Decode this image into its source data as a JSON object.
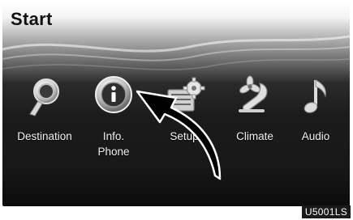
{
  "screen": {
    "title": "Start"
  },
  "menu": [
    {
      "key": "destination",
      "label": "Destination",
      "icon": "destination-magnifier-icon"
    },
    {
      "key": "info-phone",
      "label": "Info.\nPhone",
      "icon": "info-icon"
    },
    {
      "key": "setup",
      "label": "Setup",
      "icon": "setup-gear-icon"
    },
    {
      "key": "climate",
      "label": "Climate",
      "icon": "climate-fan-seat-icon"
    },
    {
      "key": "audio",
      "label": "Audio",
      "icon": "music-note-icon"
    }
  ],
  "figure_code": "U5001LS",
  "colors": {
    "background_dark": "#181818",
    "label": "#f2f2f2",
    "arrow": "#000000"
  }
}
